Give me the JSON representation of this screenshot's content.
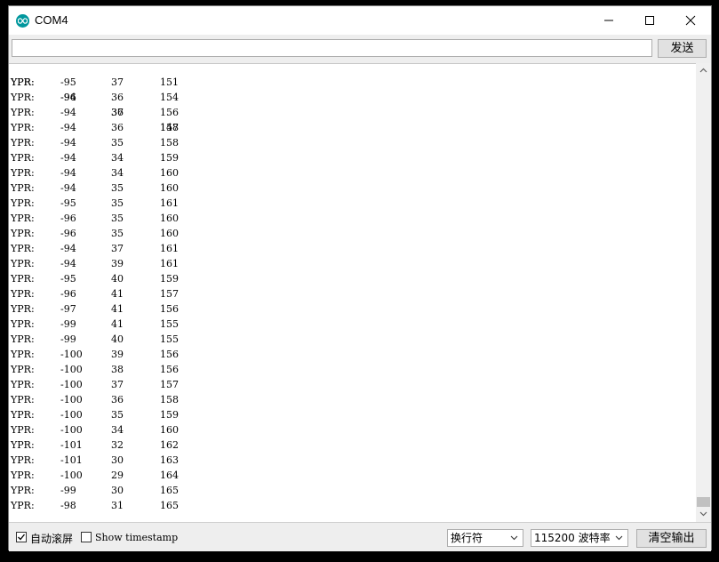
{
  "window": {
    "title": "COM4"
  },
  "toolbar": {
    "send_input_value": "",
    "send_label": "发送"
  },
  "output": {
    "partial_line": {
      "label": "YPR:",
      "y": "-96",
      "p": "36",
      "r": "148"
    },
    "lines": [
      {
        "label": "YPR:",
        "y": "-95",
        "p": "37",
        "r": "151"
      },
      {
        "label": "YPR:",
        "y": "-94",
        "p": "36",
        "r": "154"
      },
      {
        "label": "YPR:",
        "y": "-94",
        "p": "37",
        "r": "156"
      },
      {
        "label": "YPR:",
        "y": "-94",
        "p": "36",
        "r": "157"
      },
      {
        "label": "YPR:",
        "y": "-94",
        "p": "35",
        "r": "158"
      },
      {
        "label": "YPR:",
        "y": "-94",
        "p": "34",
        "r": "159"
      },
      {
        "label": "YPR:",
        "y": "-94",
        "p": "34",
        "r": "160"
      },
      {
        "label": "YPR:",
        "y": "-94",
        "p": "35",
        "r": "160"
      },
      {
        "label": "YPR:",
        "y": "-95",
        "p": "35",
        "r": "161"
      },
      {
        "label": "YPR:",
        "y": "-96",
        "p": "35",
        "r": "160"
      },
      {
        "label": "YPR:",
        "y": "-96",
        "p": "35",
        "r": "160"
      },
      {
        "label": "YPR:",
        "y": "-94",
        "p": "37",
        "r": "161"
      },
      {
        "label": "YPR:",
        "y": "-94",
        "p": "39",
        "r": "161"
      },
      {
        "label": "YPR:",
        "y": "-95",
        "p": "40",
        "r": "159"
      },
      {
        "label": "YPR:",
        "y": "-96",
        "p": "41",
        "r": "157"
      },
      {
        "label": "YPR:",
        "y": "-97",
        "p": "41",
        "r": "156"
      },
      {
        "label": "YPR:",
        "y": "-99",
        "p": "41",
        "r": "155"
      },
      {
        "label": "YPR:",
        "y": "-99",
        "p": "40",
        "r": "155"
      },
      {
        "label": "YPR:",
        "y": "-100",
        "p": "39",
        "r": "156"
      },
      {
        "label": "YPR:",
        "y": "-100",
        "p": "38",
        "r": "156"
      },
      {
        "label": "YPR:",
        "y": "-100",
        "p": "37",
        "r": "157"
      },
      {
        "label": "YPR:",
        "y": "-100",
        "p": "36",
        "r": "158"
      },
      {
        "label": "YPR:",
        "y": "-100",
        "p": "35",
        "r": "159"
      },
      {
        "label": "YPR:",
        "y": "-100",
        "p": "34",
        "r": "160"
      },
      {
        "label": "YPR:",
        "y": "-101",
        "p": "32",
        "r": "162"
      },
      {
        "label": "YPR:",
        "y": "-101",
        "p": "30",
        "r": "163"
      },
      {
        "label": "YPR:",
        "y": "-100",
        "p": "29",
        "r": "164"
      },
      {
        "label": "YPR:",
        "y": "-99",
        "p": "30",
        "r": "165"
      },
      {
        "label": "YPR:",
        "y": "-98",
        "p": "31",
        "r": "165"
      }
    ]
  },
  "statusbar": {
    "autoscroll_label": "自动滚屏",
    "autoscroll_checked": true,
    "timestamp_label": "Show timestamp",
    "timestamp_checked": false,
    "line_ending": "换行符",
    "baud_rate": "115200 波特率",
    "clear_label": "清空输出"
  },
  "colors": {
    "app_icon": "#00979d",
    "button_face": "#e1e1e1",
    "toolbar_bg": "#eeeeee"
  }
}
